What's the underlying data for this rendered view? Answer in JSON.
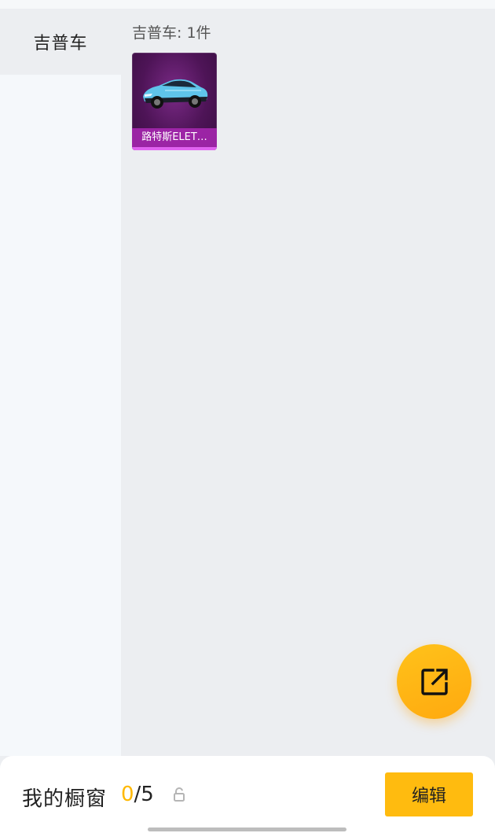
{
  "sidebar": {
    "items": [
      {
        "label": "吉普车",
        "selected": true
      }
    ]
  },
  "main": {
    "category_count": "吉普车: 1件",
    "products": [
      {
        "name": "路特斯ELET…",
        "image_icon": "car-icon"
      }
    ]
  },
  "fab": {
    "icon": "share-external-icon"
  },
  "bottom_bar": {
    "label": "我的橱窗",
    "count_current": "0",
    "count_total": "/5",
    "lock_icon": "lock-icon",
    "edit_label": "编辑"
  },
  "colors": {
    "accent": "#ffbb0f",
    "count_highlight": "#ffb800",
    "card_bg": "#4e1457",
    "card_label_bg": "#aa28b4"
  }
}
